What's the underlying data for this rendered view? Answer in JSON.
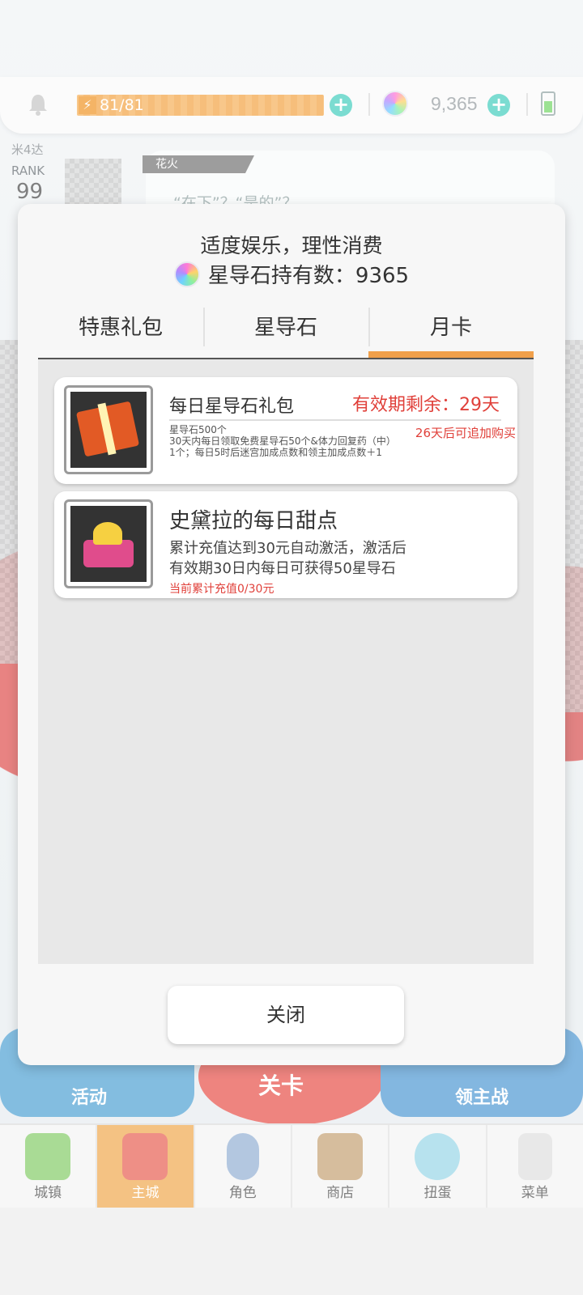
{
  "status_bar": {
    "stamina": "81/81",
    "gems": "9,365"
  },
  "player": {
    "name": "米4达",
    "rank_label": "RANK",
    "rank_value": "99"
  },
  "chat": {
    "channel": "花火",
    "text": "“在下”？“是的”？"
  },
  "home_buttons": {
    "event": "活动",
    "stage": "关卡",
    "lord": "领主战"
  },
  "bottom_nav": [
    {
      "label": "城镇",
      "icon": "town-icon"
    },
    {
      "label": "主城",
      "icon": "castle-icon"
    },
    {
      "label": "角色",
      "icon": "character-icon"
    },
    {
      "label": "商店",
      "icon": "shop-icon"
    },
    {
      "label": "扭蛋",
      "icon": "gacha-icon"
    },
    {
      "label": "菜单",
      "icon": "menu-icon"
    }
  ],
  "modal": {
    "title": "适度娱乐，理性消费",
    "holding_text": "星导石持有数：9365",
    "tabs": [
      "特惠礼包",
      "星导石",
      "月卡"
    ],
    "active_tab": "月卡",
    "cards": [
      {
        "title": "每日星导石礼包",
        "validity": "有效期剩余：29天",
        "description_lines": [
          "星导石500个",
          "30天内每日领取免费星导石50个&体力回复药（中）",
          "1个；每日5时后迷宫加成点数和领主加成点数＋1"
        ],
        "note": "26天后可追加购买",
        "icon": "gift-box-icon"
      },
      {
        "title": "史黛拉的每日甜点",
        "description_lines": [
          "累计充值达到30元自动激活，激活后",
          "有效期30日内每日可获得50星导石"
        ],
        "note": "当前累计充值0/30元",
        "icon": "cake-icon"
      }
    ],
    "close_label": "关闭"
  },
  "colors": {
    "accent_orange": "#f0a04b",
    "warning_red": "#e0403a",
    "plus_teal": "#4fd0c2"
  }
}
